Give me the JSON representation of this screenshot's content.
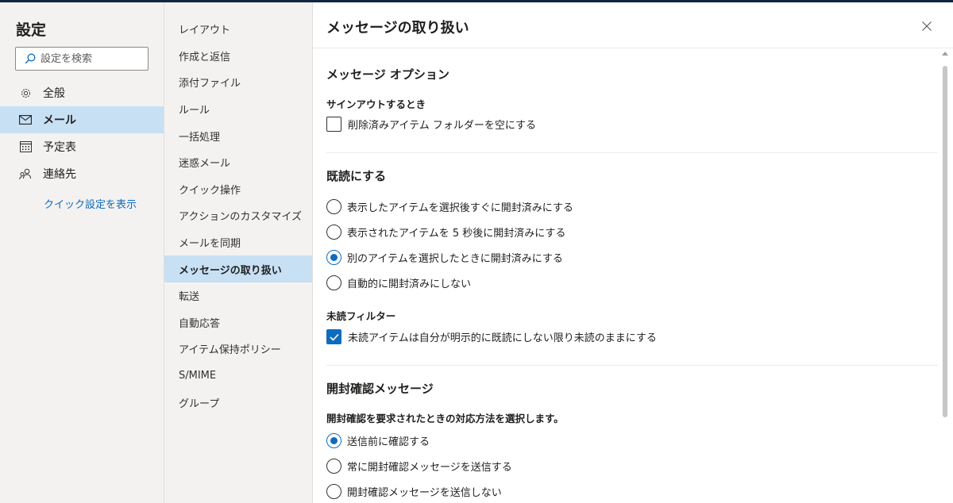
{
  "nav_left": {
    "title": "設定",
    "search_placeholder": "設定を検索",
    "items": [
      {
        "label": "全般",
        "icon": "gear-icon"
      },
      {
        "label": "メール",
        "icon": "mail-icon",
        "active": true
      },
      {
        "label": "予定表",
        "icon": "calendar-icon"
      },
      {
        "label": "連絡先",
        "icon": "people-icon"
      }
    ],
    "quick_settings": "クイック設定を表示"
  },
  "nav_sub": {
    "items": [
      "レイアウト",
      "作成と返信",
      "添付ファイル",
      "ルール",
      "一括処理",
      "迷惑メール",
      "クイック操作",
      "アクションのカスタマイズ",
      "メールを同期",
      "メッセージの取り扱い",
      "転送",
      "自動応答",
      "アイテム保持ポリシー",
      "S/MIME",
      "グループ"
    ],
    "active": "メッセージの取り扱い"
  },
  "main": {
    "title": "メッセージの取り扱い",
    "sections": {
      "options": {
        "heading": "メッセージ オプション",
        "subheading": "サインアウトするとき",
        "checkbox_empty_deleted": {
          "label": "削除済みアイテム フォルダーを空にする",
          "checked": false
        }
      },
      "mark_read": {
        "heading": "既読にする",
        "radios": [
          {
            "label": "表示したアイテムを選択後すぐに開封済みにする",
            "selected": false
          },
          {
            "label": "表示されたアイテムを 5 秒後に開封済みにする",
            "selected": false
          },
          {
            "label": "別のアイテムを選択したときに開封済みにする",
            "selected": true
          },
          {
            "label": "自動的に開封済みにしない",
            "selected": false
          }
        ],
        "unread_filter_heading": "未読フィルター",
        "unread_filter_checkbox": {
          "label": "未読アイテムは自分が明示的に既読にしない限り未読のままにする",
          "checked": true
        }
      },
      "read_receipts": {
        "heading": "開封確認メッセージ",
        "subheading": "開封確認を要求されたときの対応方法を選択します。",
        "radios": [
          {
            "label": "送信前に確認する",
            "selected": true
          },
          {
            "label": "常に開封確認メッセージを送信する",
            "selected": false
          },
          {
            "label": "開封確認メッセージを送信しない",
            "selected": false
          }
        ]
      }
    }
  },
  "colors": {
    "accent": "#0f6cbd",
    "nav_bg": "#f3f2f1",
    "active_bg": "#c7e0f4"
  }
}
